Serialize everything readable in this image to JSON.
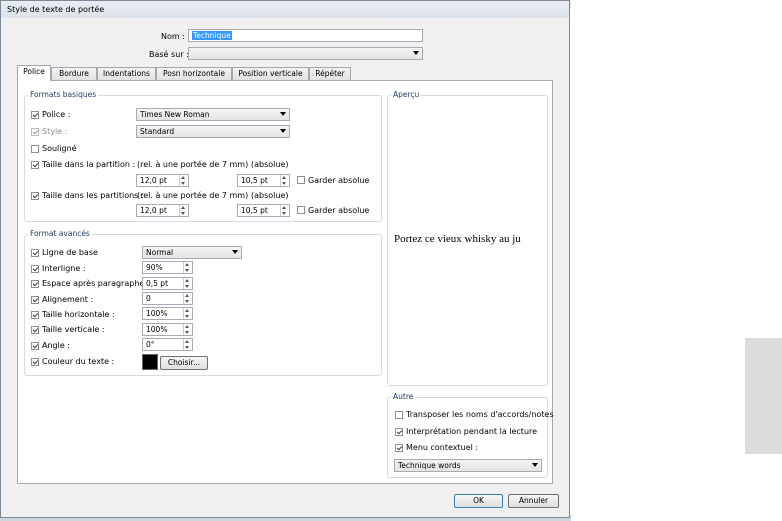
{
  "dialog": {
    "title": "Style de texte de portée",
    "name_label": "Nom :",
    "name_value": "Technique",
    "based_label": "Basé sur :",
    "based_value": ""
  },
  "tabs": [
    {
      "label": "Police",
      "active": true
    },
    {
      "label": "Bordure"
    },
    {
      "label": "Indentations"
    },
    {
      "label": "Posn horizontale"
    },
    {
      "label": "Position verticale"
    },
    {
      "label": "Répéter"
    }
  ],
  "basic": {
    "title": "Formats basiques",
    "font_label": "Police :",
    "font_value": "Times New Roman",
    "style_label": "Style :",
    "style_value": "Standard",
    "underline_label": "Souligné",
    "size_part_label": "Taille dans la partition :",
    "size_parts_label": "Taille dans les partitions :",
    "rel_label": "(rel. à une portée de 7 mm)",
    "abs_label": "(absolue)",
    "rel_value_1": "12,0 pt",
    "abs_value_1": "10,5 pt",
    "rel_value_2": "12,0 pt",
    "abs_value_2": "10,5 pt",
    "keep_abs_label": "Garder absolue"
  },
  "advanced": {
    "title": "Format avancés",
    "baseline_label": "Ligne de base",
    "baseline_value": "Normal",
    "interline_label": "Interligne :",
    "interline_value": "90%",
    "space_label": "Espace après paragraphe :",
    "space_value": "0,5 pt",
    "align_label": "Alignement :",
    "align_value": "0",
    "hsize_label": "Taille horizontale :",
    "hsize_value": "100%",
    "vsize_label": "Taille verticale :",
    "vsize_value": "100%",
    "angle_label": "Angle :",
    "angle_value": "0°",
    "color_label": "Couleur du texte :",
    "color_value": "#000000",
    "choose_label": "Choisir..."
  },
  "preview": {
    "title": "Aperçu",
    "text": "Portez ce vieux whisky au ju"
  },
  "other": {
    "title": "Autre",
    "transpose_label": "Transposer les noms d'accords/notes",
    "interp_label": "Interprétation pendant la lecture",
    "menu_label": "Menu contextuel :",
    "menu_value": "Technique words"
  },
  "buttons": {
    "ok": "OK",
    "cancel": "Annuler"
  }
}
